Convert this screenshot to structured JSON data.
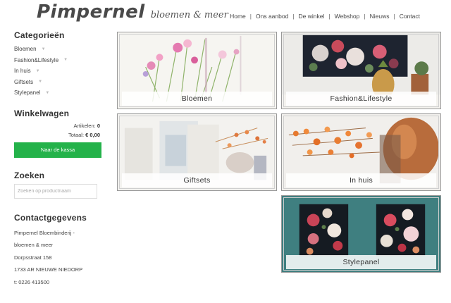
{
  "header": {
    "logo_main": "Pimpernel",
    "logo_sub": "bloemen & meer",
    "nav": [
      "Home",
      "Ons aanbod",
      "De winkel",
      "Webshop",
      "Nieuws",
      "Contact"
    ]
  },
  "sidebar": {
    "categories_title": "Categorieën",
    "categories": [
      "Bloemen",
      "Fashion&Lifestyle",
      "In huis",
      "Giftsets",
      "Stylepanel"
    ],
    "cart_title": "Winkelwagen",
    "cart_items_label": "Artikelen:",
    "cart_items_value": "0",
    "cart_total_label": "Totaal:",
    "cart_total_value": "€ 0,00",
    "checkout_label": "Naar de kassa",
    "search_title": "Zoeken",
    "search_placeholder": "Zoeken op productnaam",
    "contact_title": "Contactgegevens",
    "contact_lines": [
      "Pimpernel Bloembinderij -",
      "bloemen & meer",
      "Dorpsstraat 158",
      "1733 AR NIEUWE NIEDORP",
      "t: 0226 413500"
    ]
  },
  "tiles": [
    {
      "label": "Bloemen"
    },
    {
      "label": "Fashion&Lifestyle"
    },
    {
      "label": "Giftsets"
    },
    {
      "label": "In huis"
    },
    {
      "label": "Stylepanel"
    }
  ],
  "colors": {
    "accent_green": "#24b24a",
    "text_dark": "#333333"
  }
}
